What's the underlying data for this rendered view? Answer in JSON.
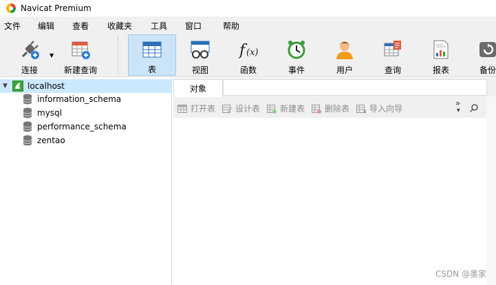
{
  "window": {
    "title": "Navicat Premium"
  },
  "menu": [
    "文件",
    "编辑",
    "查看",
    "收藏夹",
    "工具",
    "窗口",
    "帮助"
  ],
  "toolbar": {
    "connect_label": "连接",
    "new_query_label": "新建查询",
    "items": [
      {
        "label": "表",
        "icon": "table-icon",
        "active": true
      },
      {
        "label": "视图",
        "icon": "view-icon",
        "active": false
      },
      {
        "label": "函数",
        "icon": "function-icon",
        "active": false
      },
      {
        "label": "事件",
        "icon": "event-clock-icon",
        "active": false
      },
      {
        "label": "用户",
        "icon": "user-icon",
        "active": false
      },
      {
        "label": "查询",
        "icon": "query-icon",
        "active": false
      },
      {
        "label": "报表",
        "icon": "report-icon",
        "active": false
      },
      {
        "label": "备份",
        "icon": "backup-icon",
        "active": false
      }
    ]
  },
  "tree": {
    "connection": "localhost",
    "databases": [
      "information_schema",
      "mysql",
      "performance_schema",
      "zentao"
    ]
  },
  "objects": {
    "tab_label": "对象",
    "actions": [
      "打开表",
      "设计表",
      "新建表",
      "删除表",
      "导入向导"
    ]
  },
  "watermark": "CSDN @墨家",
  "colors": {
    "accent_active_bg": "#cce4f7",
    "tree_selected_bg": "#cce8ff",
    "connection_green": "#3aa53a"
  }
}
